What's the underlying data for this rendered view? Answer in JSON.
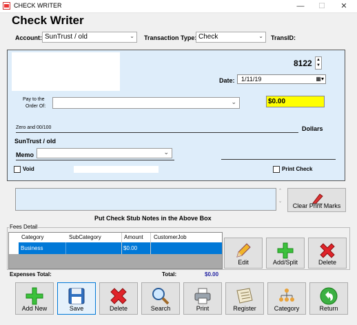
{
  "window": {
    "title": "CHECK WRITER",
    "minimize": "—",
    "maximize": "☐",
    "close": "✕"
  },
  "heading": "Check Writer",
  "top": {
    "account_label": "Account:",
    "account_value": "SunTrust / old",
    "transaction_type_label": "Transaction Type:",
    "transaction_type_value": "Check",
    "transid_label": "TransID:"
  },
  "check": {
    "number": "8122",
    "date_label": "Date:",
    "date_value": "1/11/19",
    "pay_to_label_1": "Pay to  the",
    "pay_to_label_2": "Order Of:",
    "amount": "$0.00",
    "amount_words": "Zero and 00/100",
    "dollars_label": "Dollars",
    "bank_name": "SunTrust / old",
    "memo_label": "Memo",
    "void_label": "Void",
    "print_check_label": "Print Check"
  },
  "stub": {
    "caption": "Put Check Stub Notes in the Above Box",
    "clear_print_marks": "Clear Print Marks"
  },
  "fees": {
    "group_label": "Fees Detail",
    "columns": [
      "Category",
      "SubCategory",
      "Amount",
      "CustomerJob"
    ],
    "row": {
      "category": "Business",
      "subcategory": "",
      "amount": "$0.00",
      "customerjob": ""
    },
    "expenses_total_label": "Expenses Total:",
    "total_label": "Total:",
    "total_value": "$0.00",
    "edit": "Edit",
    "add_split": "Add/Split",
    "delete": "Delete"
  },
  "toolbar": {
    "add_new": "Add New",
    "save": "Save",
    "delete": "Delete",
    "search": "Search",
    "print": "Print",
    "register": "Register",
    "category": "Category",
    "return": "Return"
  },
  "colors": {
    "check_bg": "#deedfa",
    "amount_bg": "#ffff00",
    "selected_row": "#0078d7",
    "total_blue": "#1f1fa0"
  }
}
